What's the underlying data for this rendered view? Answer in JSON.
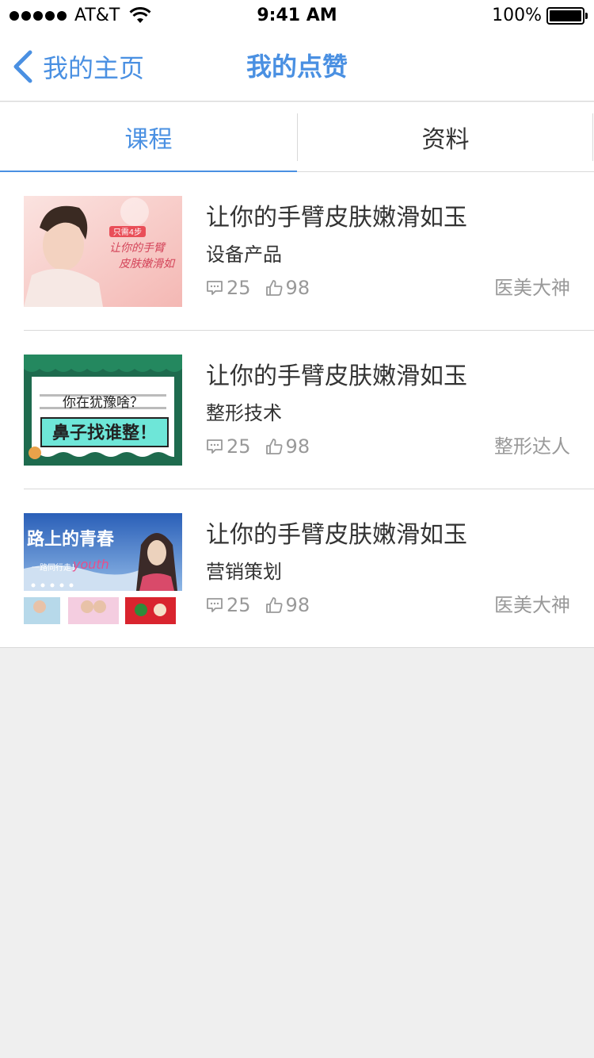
{
  "status_bar": {
    "carrier": "AT&T",
    "time": "9:41 AM",
    "battery": "100%"
  },
  "nav": {
    "back_label": "我的主页",
    "title": "我的点赞"
  },
  "tabs": [
    {
      "label": "课程",
      "active": true
    },
    {
      "label": "资料",
      "active": false
    }
  ],
  "items": [
    {
      "title": "让你的手臂皮肤嫩滑如玉",
      "category": "设备产品",
      "comments": "25",
      "likes": "98",
      "author": "医美大神",
      "thumb_texts": [
        "只需4步",
        "让你的手臂",
        "皮肤嫩滑如"
      ]
    },
    {
      "title": "让你的手臂皮肤嫩滑如玉",
      "category": "整形技术",
      "comments": "25",
      "likes": "98",
      "author": "整形达人",
      "thumb_texts": [
        "你在犹豫啥？",
        "鼻子找谁整！"
      ]
    },
    {
      "title": "让你的手臂皮肤嫩滑如玉",
      "category": "营销策划",
      "comments": "25",
      "likes": "98",
      "author": "医美大神",
      "thumb_texts": [
        "路上的青春",
        "一路同行走！",
        "youth"
      ]
    }
  ],
  "colors": {
    "accent": "#4a90e2",
    "text": "#333333",
    "muted": "#999999",
    "background": "#efefef"
  }
}
